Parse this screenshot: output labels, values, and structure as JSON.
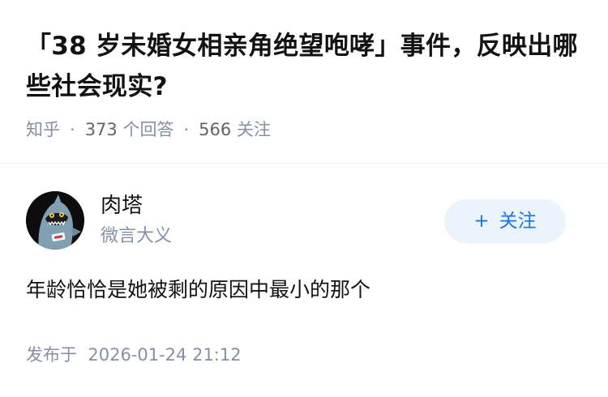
{
  "question": {
    "title": "「38 岁未婚女相亲角绝望咆哮」事件，反映出哪些社会现实?",
    "source": "知乎",
    "answer_count": "373",
    "answer_label": "个回答",
    "follower_count": "566",
    "follower_label": "关注"
  },
  "author": {
    "name": "肉塔",
    "description": "微言大义",
    "avatar_icon": "shark-avatar-icon"
  },
  "follow_button": {
    "plus": "+",
    "label": "关注"
  },
  "answer": {
    "content": "年龄恰恰是她被剩的原因中最小的那个",
    "publish_label": "发布于",
    "publish_time": "2026-01-24 21:12"
  },
  "colors": {
    "title": "#121212",
    "meta": "#8590a6",
    "accent": "#1772f6",
    "follow_bg": "#ebf3fc"
  }
}
